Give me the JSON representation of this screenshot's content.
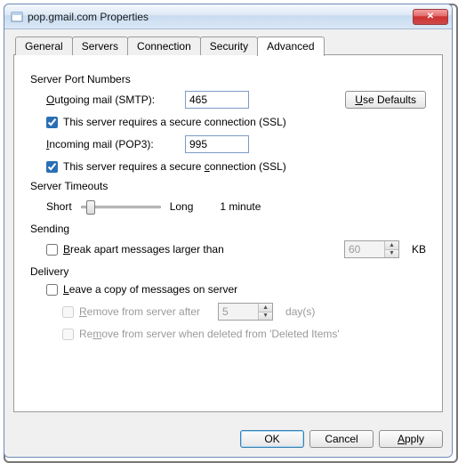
{
  "window": {
    "title": "pop.gmail.com Properties"
  },
  "tabs": {
    "general": "General",
    "servers": "Servers",
    "connection": "Connection",
    "security": "Security",
    "advanced": "Advanced"
  },
  "sections": {
    "port_header": "Server Port Numbers",
    "smtp_pre": "",
    "smtp_underline": "O",
    "smtp_rest": "utgoing mail (SMTP):",
    "smtp_value": "465",
    "use_defaults_pre": "",
    "use_defaults_u": "U",
    "use_defaults_rest": "se Defaults",
    "ssl_smtp_text": "This server requires a secure connection (SSL)",
    "ssl_smtp_checked": true,
    "pop3_pre": "",
    "pop3_u": "I",
    "pop3_rest": "ncoming mail (POP3):",
    "pop3_value": "995",
    "ssl_pop_text_pre": "This server requires a secure ",
    "ssl_pop_u": "c",
    "ssl_pop_text_post": "onnection (SSL)",
    "ssl_pop_checked": true,
    "timeouts_header": "Server Timeouts",
    "short": "Short",
    "long": "Long",
    "minute": "1 minute",
    "sending_header": "Sending",
    "break_pre": "",
    "break_u": "B",
    "break_rest": "reak apart messages larger than",
    "break_value": "60",
    "break_checked": false,
    "kb": "KB",
    "delivery_header": "Delivery",
    "leave_pre": "",
    "leave_u": "L",
    "leave_rest": "eave a copy of messages on server",
    "leave_checked": false,
    "remove_after_pre": "",
    "remove_after_u": "R",
    "remove_after_rest": "emove from server after",
    "days_value": "5",
    "days_unit": "day(s)",
    "remove_deleted_pre": "Re",
    "remove_deleted_u": "m",
    "remove_deleted_rest": "ove from server when deleted from 'Deleted Items'"
  },
  "buttons": {
    "ok": "OK",
    "cancel": "Cancel",
    "apply_u": "A",
    "apply_rest": "pply"
  }
}
